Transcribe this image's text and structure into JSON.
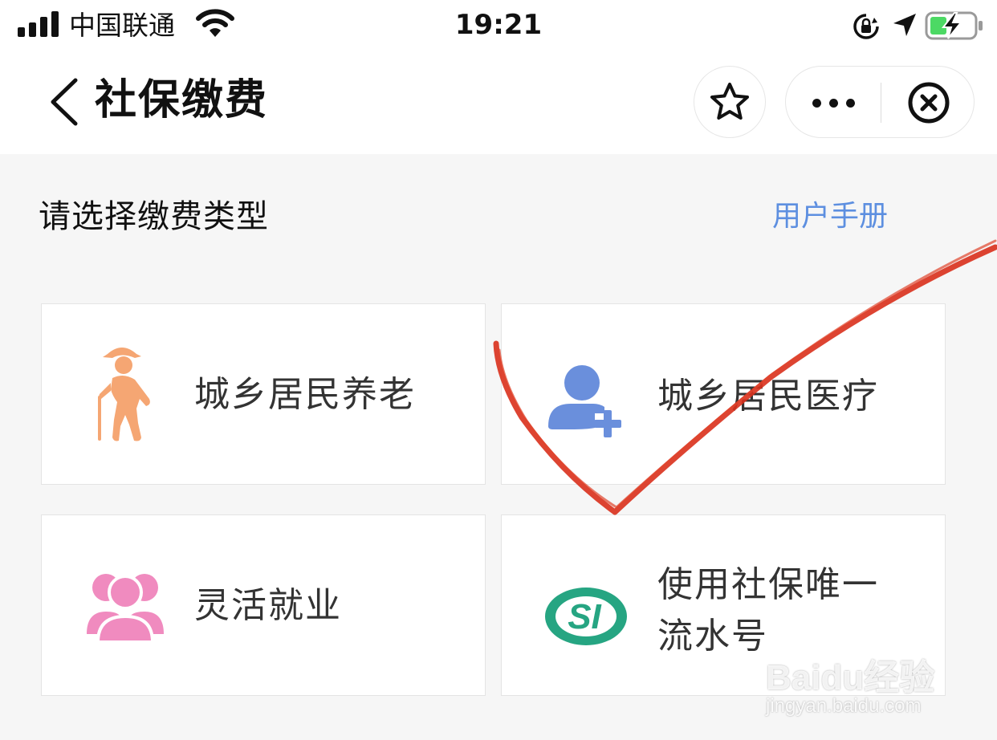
{
  "status_bar": {
    "carrier": "中国联通",
    "time": "19:21"
  },
  "nav": {
    "title": "社保缴费"
  },
  "section": {
    "title": "请选择缴费类型",
    "manual_link": "用户手册"
  },
  "cards": [
    {
      "label": "城乡居民养老",
      "icon": "elderly-person-icon",
      "icon_color": "#f5a673"
    },
    {
      "label": "城乡居民医疗",
      "icon": "add-user-icon",
      "icon_color": "#6a8fdc"
    },
    {
      "label": "灵活就业",
      "icon": "group-icon",
      "icon_color": "#f08bbf"
    },
    {
      "label_line1": "使用社保唯一",
      "label_line2": "流水号",
      "icon": "social-insurance-logo",
      "icon_color": "#26a582"
    }
  ],
  "colors": {
    "link": "#5d8fe0",
    "annotation": "#d9301c",
    "background": "#f6f6f6"
  },
  "watermark": {
    "logo": "Baidu经验",
    "url": "jingyan.baidu.com"
  }
}
